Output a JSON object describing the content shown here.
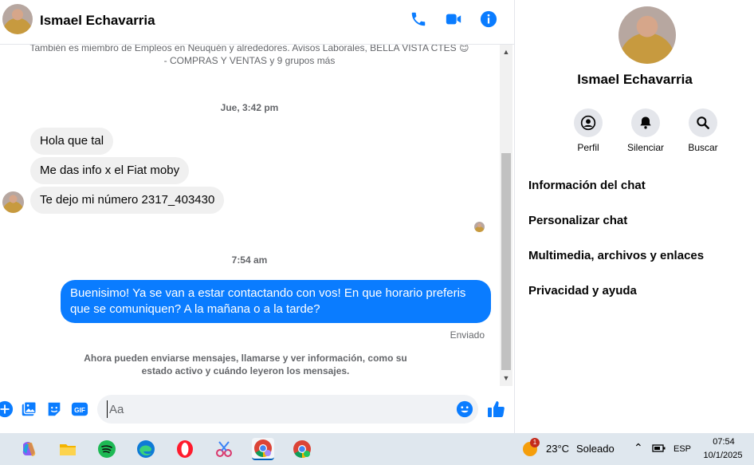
{
  "header": {
    "contact_name": "Ismael Echavarria",
    "icons": [
      "phone-icon",
      "video-call-icon",
      "info-icon"
    ]
  },
  "conversation": {
    "intro_line1": "También es miembro de Empleos en Neuquén y alrededores. Avisos Laborales, BELLA VISTA CTES 😊",
    "intro_line2": "- COMPRAS Y VENTAS y 9 grupos más",
    "timestamp1": "Jue, 3:42 pm",
    "incoming": [
      "Hola que tal",
      "Me das info x el Fiat moby",
      "Te dejo mi número 2317_403430"
    ],
    "timestamp2": "7:54 am",
    "outgoing": "Buenisimo! Ya se van a estar contactando con vos! En que horario preferis que se comuniquen? A la mañana o a la tarde?",
    "status": "Enviado",
    "footer_note": "Ahora pueden enviarse mensajes, llamarse y ver información, como su estado activo y cuándo leyeron los mensajes."
  },
  "composer": {
    "placeholder": "Aa",
    "icons": [
      "plus-icon",
      "image-icon",
      "sticker-icon",
      "gif-icon",
      "emoji-icon",
      "thumbs-up-icon"
    ],
    "gif_label": "GIF"
  },
  "side_panel": {
    "name": "Ismael Echavarria",
    "actions": [
      {
        "label": "Perfil",
        "icon": "profile-icon"
      },
      {
        "label": "Silenciar",
        "icon": "bell-icon"
      },
      {
        "label": "Buscar",
        "icon": "search-icon"
      }
    ],
    "items": [
      "Información del chat",
      "Personalizar chat",
      "Multimedia, archivos y enlaces",
      "Privacidad y ayuda"
    ]
  },
  "taskbar": {
    "weather_temp": "23°C",
    "weather_desc": "Soleado",
    "weather_badge": "1",
    "language": "ESP",
    "time": "07:54",
    "date": "10/1/2025"
  },
  "colors": {
    "accent": "#0a7cff",
    "incoming_bubble": "#f0f0f0",
    "taskbar": "#dfe7ee"
  }
}
